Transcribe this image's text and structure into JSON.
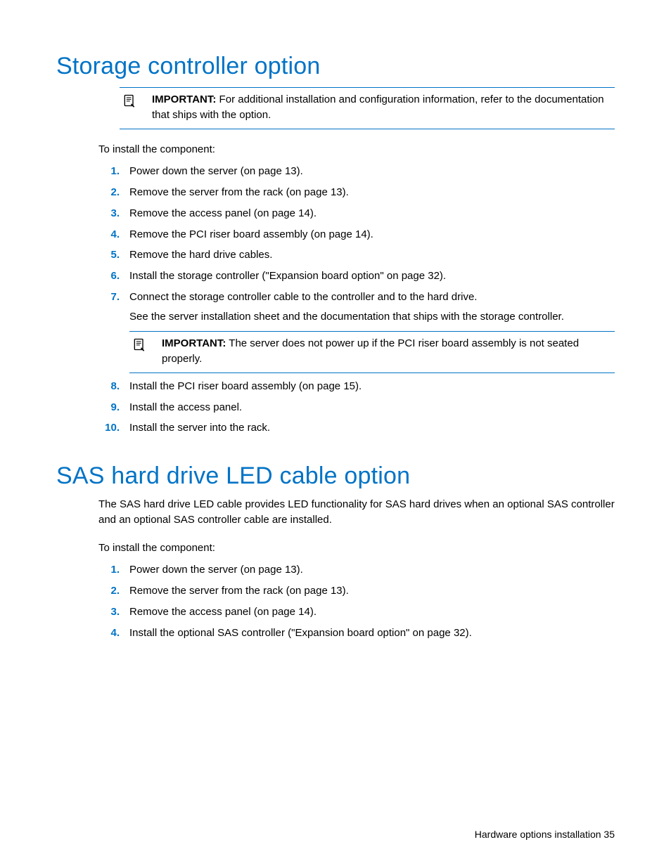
{
  "section1": {
    "title": "Storage controller option",
    "callout1": {
      "label": "IMPORTANT:",
      "text": "  For additional installation and configuration information, refer to the documentation that ships with the option."
    },
    "intro": "To install the component:",
    "steps": {
      "s1": {
        "n": "1.",
        "t": "Power down the server (on page 13)."
      },
      "s2": {
        "n": "2.",
        "t": "Remove the server from the rack (on page 13)."
      },
      "s3": {
        "n": "3.",
        "t": "Remove the access panel (on page 14)."
      },
      "s4": {
        "n": "4.",
        "t": "Remove the PCI riser board assembly (on page 14)."
      },
      "s5": {
        "n": "5.",
        "t": "Remove the hard drive cables."
      },
      "s6": {
        "n": "6.",
        "t": "Install the storage controller (\"Expansion board option\" on page 32)."
      },
      "s7": {
        "n": "7.",
        "t": "Connect the storage controller cable to the controller and to the hard drive.",
        "sub": "See the server installation sheet and the documentation that ships with the storage controller."
      },
      "s8": {
        "n": "8.",
        "t": "Install the PCI riser board assembly (on page 15)."
      },
      "s9": {
        "n": "9.",
        "t": "Install the access panel."
      },
      "s10": {
        "n": "10.",
        "t": "Install the server into the rack."
      }
    },
    "callout2": {
      "label": "IMPORTANT:",
      "text": "  The server does not power up if the PCI riser board assembly is not seated properly."
    }
  },
  "section2": {
    "title": "SAS hard drive LED cable option",
    "para": "The SAS hard drive LED cable provides LED functionality for SAS hard drives when an optional SAS controller and an optional SAS controller cable are installed.",
    "intro": "To install the component:",
    "steps": {
      "s1": {
        "n": "1.",
        "t": "Power down the server (on page 13)."
      },
      "s2": {
        "n": "2.",
        "t": "Remove the server from the rack (on page 13)."
      },
      "s3": {
        "n": "3.",
        "t": "Remove the access panel (on page 14)."
      },
      "s4": {
        "n": "4.",
        "t": "Install the optional SAS controller (\"Expansion board option\" on page 32)."
      }
    }
  },
  "footer": {
    "text": "Hardware options installation   35"
  }
}
